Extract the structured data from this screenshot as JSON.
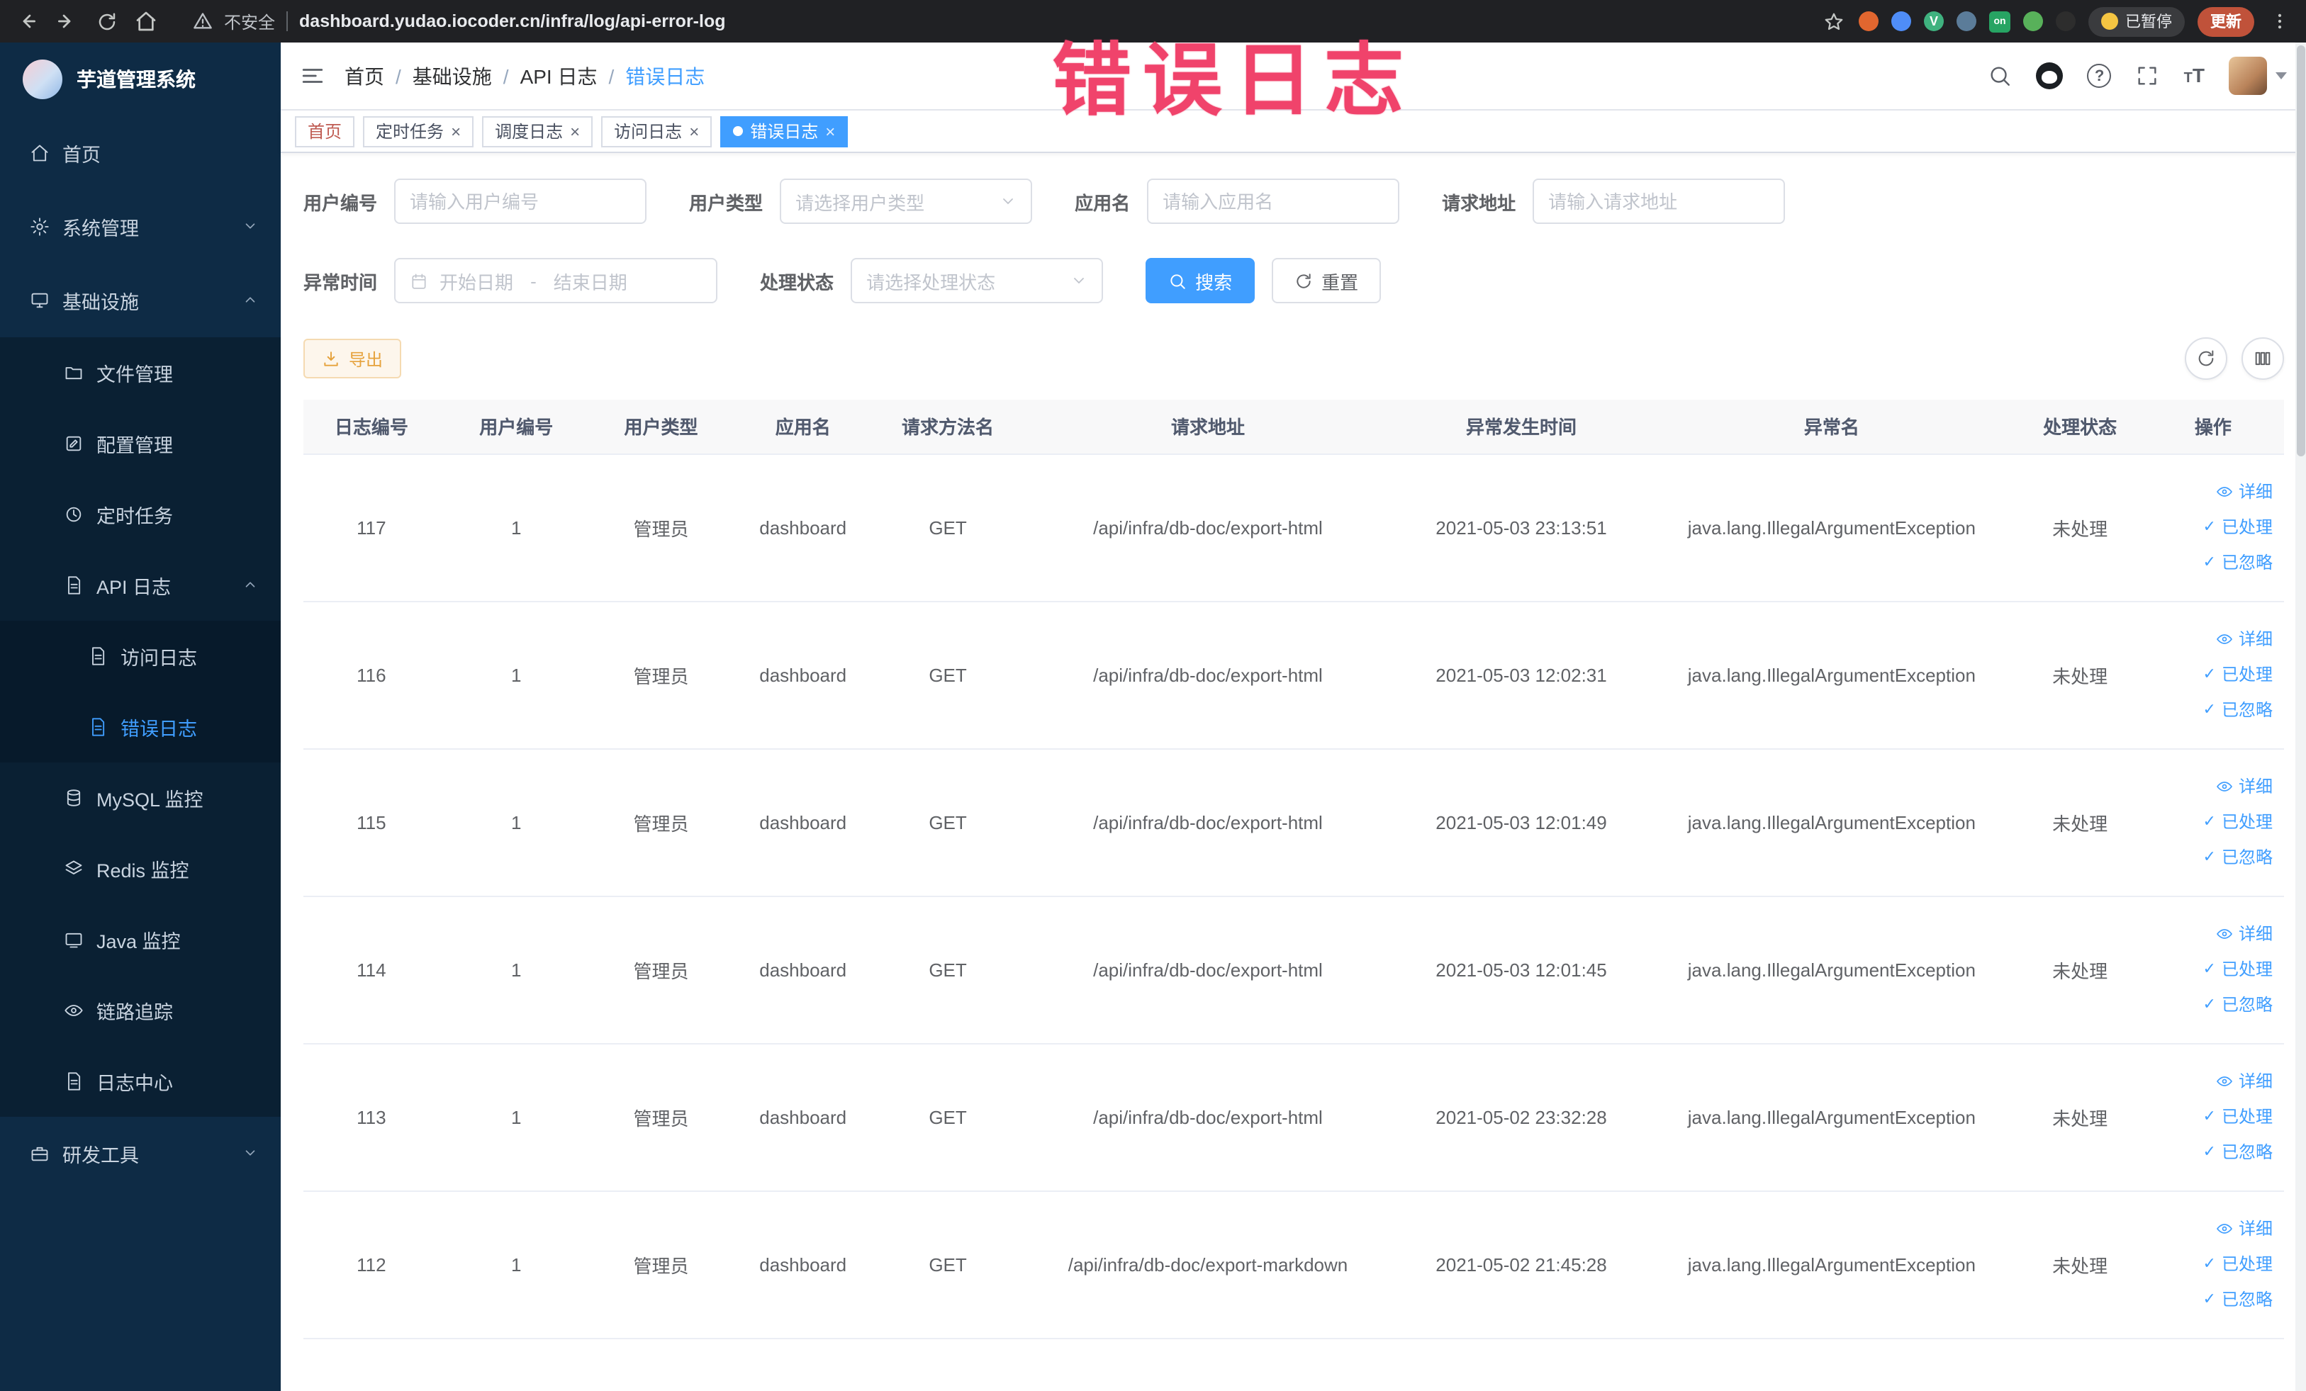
{
  "browser": {
    "security_label": "不安全",
    "url": "dashboard.yudao.iocoder.cn/infra/log/api-error-log",
    "extension_badge": "on",
    "paused_label": "已暂停",
    "update_label": "更新"
  },
  "annotation": {
    "text": "错误日志"
  },
  "sidebar": {
    "logo_title": "芋道管理系统",
    "items": [
      {
        "label": "首页"
      },
      {
        "label": "系统管理"
      },
      {
        "label": "基础设施"
      },
      {
        "label": "文件管理"
      },
      {
        "label": "配置管理"
      },
      {
        "label": "定时任务"
      },
      {
        "label": "API 日志"
      },
      {
        "label": "访问日志"
      },
      {
        "label": "错误日志"
      },
      {
        "label": "MySQL 监控"
      },
      {
        "label": "Redis 监控"
      },
      {
        "label": "Java 监控"
      },
      {
        "label": "链路追踪"
      },
      {
        "label": "日志中心"
      },
      {
        "label": "研发工具"
      }
    ]
  },
  "breadcrumb": {
    "separator": "/",
    "items": [
      "首页",
      "基础设施",
      "API 日志",
      "错误日志"
    ]
  },
  "tabs": [
    {
      "label": "首页"
    },
    {
      "label": "定时任务"
    },
    {
      "label": "调度日志"
    },
    {
      "label": "访问日志"
    },
    {
      "label": "错误日志"
    }
  ],
  "filters": {
    "user_id": {
      "label": "用户编号",
      "placeholder": "请输入用户编号"
    },
    "user_type": {
      "label": "用户类型",
      "placeholder": "请选择用户类型"
    },
    "app_name": {
      "label": "应用名",
      "placeholder": "请输入应用名"
    },
    "request_url": {
      "label": "请求地址",
      "placeholder": "请输入请求地址"
    },
    "exception_time": {
      "label": "异常时间",
      "start_placeholder": "开始日期",
      "separator": "-",
      "end_placeholder": "结束日期"
    },
    "process_status": {
      "label": "处理状态",
      "placeholder": "请选择处理状态"
    },
    "search_label": "搜索",
    "reset_label": "重置"
  },
  "toolbar": {
    "export_label": "导出"
  },
  "table": {
    "columns": [
      "日志编号",
      "用户编号",
      "用户类型",
      "应用名",
      "请求方法名",
      "请求地址",
      "异常发生时间",
      "异常名",
      "处理状态",
      "操作"
    ],
    "rows": [
      {
        "id": "117",
        "user_id": "1",
        "user_type": "管理员",
        "app": "dashboard",
        "method": "GET",
        "url": "/api/infra/db-doc/export-html",
        "time": "2021-05-03 23:13:51",
        "exception": "java.lang.IllegalArgumentException",
        "status": "未处理"
      },
      {
        "id": "116",
        "user_id": "1",
        "user_type": "管理员",
        "app": "dashboard",
        "method": "GET",
        "url": "/api/infra/db-doc/export-html",
        "time": "2021-05-03 12:02:31",
        "exception": "java.lang.IllegalArgumentException",
        "status": "未处理"
      },
      {
        "id": "115",
        "user_id": "1",
        "user_type": "管理员",
        "app": "dashboard",
        "method": "GET",
        "url": "/api/infra/db-doc/export-html",
        "time": "2021-05-03 12:01:49",
        "exception": "java.lang.IllegalArgumentException",
        "status": "未处理"
      },
      {
        "id": "114",
        "user_id": "1",
        "user_type": "管理员",
        "app": "dashboard",
        "method": "GET",
        "url": "/api/infra/db-doc/export-html",
        "time": "2021-05-03 12:01:45",
        "exception": "java.lang.IllegalArgumentException",
        "status": "未处理"
      },
      {
        "id": "113",
        "user_id": "1",
        "user_type": "管理员",
        "app": "dashboard",
        "method": "GET",
        "url": "/api/infra/db-doc/export-html",
        "time": "2021-05-02 23:32:28",
        "exception": "java.lang.IllegalArgumentException",
        "status": "未处理"
      },
      {
        "id": "112",
        "user_id": "1",
        "user_type": "管理员",
        "app": "dashboard",
        "method": "GET",
        "url": "/api/infra/db-doc/export-markdown",
        "time": "2021-05-02 21:45:28",
        "exception": "java.lang.IllegalArgumentException",
        "status": "未处理"
      }
    ]
  },
  "actions": {
    "detail": "详细",
    "processed": "已处理",
    "ignored": "已忽略"
  },
  "colors": {
    "primary": "#409EFF",
    "sidebar_bg": "#0e2b45",
    "annotation": "#f0436b",
    "warning": "#e6a23c"
  }
}
